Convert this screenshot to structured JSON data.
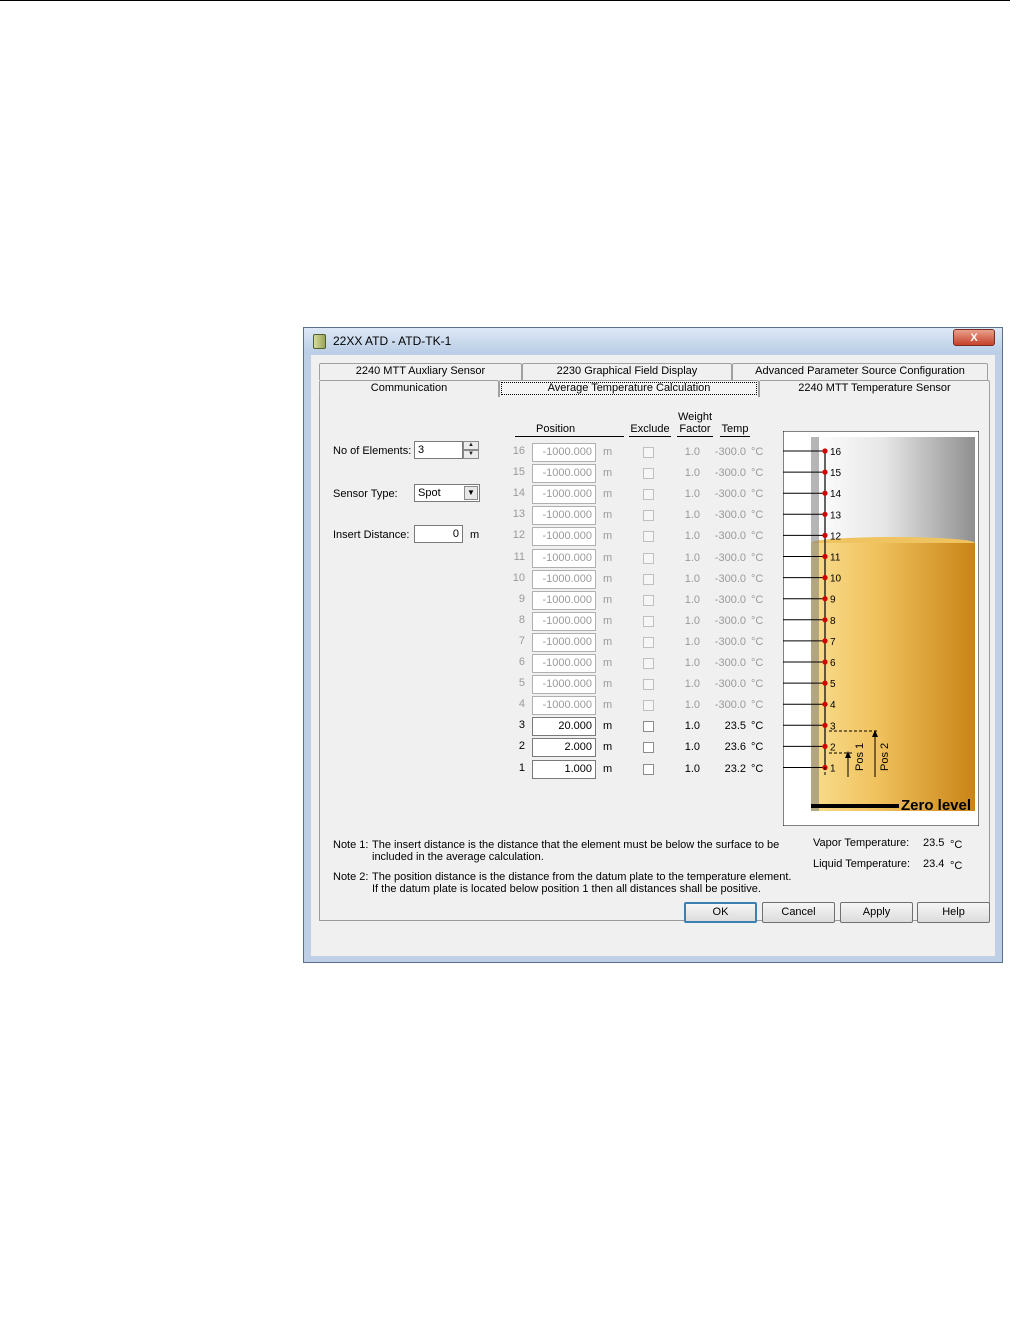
{
  "window": {
    "title": "22XX ATD  - ATD-TK-1",
    "close_label": "X"
  },
  "tabs": {
    "back": [
      {
        "label": "2240 MTT Auxliary Sensor"
      },
      {
        "label": "2230 Graphical Field Display"
      },
      {
        "label": "Advanced Parameter Source Configuration"
      }
    ],
    "front": [
      {
        "label": "Communication"
      },
      {
        "label": "Average Temperature Calculation",
        "active": true
      },
      {
        "label": "2240 MTT Temperature Sensor"
      }
    ]
  },
  "form": {
    "no_elements_label": "No of Elements:",
    "no_elements_value": "3",
    "sensor_type_label": "Sensor Type:",
    "sensor_type_value": "Spot",
    "insert_distance_label": "Insert Distance:",
    "insert_distance_value": "0",
    "insert_distance_unit": "m"
  },
  "table": {
    "headers": {
      "position": "Position",
      "exclude": "Exclude",
      "weight_factor_1": "Weight",
      "weight_factor_2": "Factor",
      "temp": "Temp"
    },
    "rows": [
      {
        "num": "16",
        "position": "-1000.000",
        "unit": "m",
        "weight": "1.0",
        "temp": "-300.0",
        "temp_unit": "°C",
        "enabled": false
      },
      {
        "num": "15",
        "position": "-1000.000",
        "unit": "m",
        "weight": "1.0",
        "temp": "-300.0",
        "temp_unit": "°C",
        "enabled": false
      },
      {
        "num": "14",
        "position": "-1000.000",
        "unit": "m",
        "weight": "1.0",
        "temp": "-300.0",
        "temp_unit": "°C",
        "enabled": false
      },
      {
        "num": "13",
        "position": "-1000.000",
        "unit": "m",
        "weight": "1.0",
        "temp": "-300.0",
        "temp_unit": "°C",
        "enabled": false
      },
      {
        "num": "12",
        "position": "-1000.000",
        "unit": "m",
        "weight": "1.0",
        "temp": "-300.0",
        "temp_unit": "°C",
        "enabled": false
      },
      {
        "num": "11",
        "position": "-1000.000",
        "unit": "m",
        "weight": "1.0",
        "temp": "-300.0",
        "temp_unit": "°C",
        "enabled": false
      },
      {
        "num": "10",
        "position": "-1000.000",
        "unit": "m",
        "weight": "1.0",
        "temp": "-300.0",
        "temp_unit": "°C",
        "enabled": false
      },
      {
        "num": "9",
        "position": "-1000.000",
        "unit": "m",
        "weight": "1.0",
        "temp": "-300.0",
        "temp_unit": "°C",
        "enabled": false
      },
      {
        "num": "8",
        "position": "-1000.000",
        "unit": "m",
        "weight": "1.0",
        "temp": "-300.0",
        "temp_unit": "°C",
        "enabled": false
      },
      {
        "num": "7",
        "position": "-1000.000",
        "unit": "m",
        "weight": "1.0",
        "temp": "-300.0",
        "temp_unit": "°C",
        "enabled": false
      },
      {
        "num": "6",
        "position": "-1000.000",
        "unit": "m",
        "weight": "1.0",
        "temp": "-300.0",
        "temp_unit": "°C",
        "enabled": false
      },
      {
        "num": "5",
        "position": "-1000.000",
        "unit": "m",
        "weight": "1.0",
        "temp": "-300.0",
        "temp_unit": "°C",
        "enabled": false
      },
      {
        "num": "4",
        "position": "-1000.000",
        "unit": "m",
        "weight": "1.0",
        "temp": "-300.0",
        "temp_unit": "°C",
        "enabled": false
      },
      {
        "num": "3",
        "position": "20.000",
        "unit": "m",
        "weight": "1.0",
        "temp": "23.5",
        "temp_unit": "°C",
        "enabled": true
      },
      {
        "num": "2",
        "position": "2.000",
        "unit": "m",
        "weight": "1.0",
        "temp": "23.6",
        "temp_unit": "°C",
        "enabled": true
      },
      {
        "num": "1",
        "position": "1.000",
        "unit": "m",
        "weight": "1.0",
        "temp": "23.2",
        "temp_unit": "°C",
        "enabled": true
      }
    ]
  },
  "tank": {
    "element_labels": [
      "16",
      "15",
      "14",
      "13",
      "12",
      "11",
      "10",
      "9",
      "8",
      "7",
      "6",
      "5",
      "4",
      "3",
      "2",
      "1"
    ],
    "pos1_label": "Pos 1",
    "pos2_label": "Pos 2",
    "zero_level_label": "Zero level",
    "colors": {
      "liquid": "#d9a132",
      "vapor": "#e0e0e0",
      "marker": "#d40000"
    },
    "vapor_temp_label": "Vapor Temperature:",
    "vapor_temp_value": "23.5",
    "liquid_temp_label": "Liquid Temperature:",
    "liquid_temp_value": "23.4",
    "temp_unit": "°C"
  },
  "notes": {
    "note1_label": "Note 1:",
    "note1_line1": "The insert distance is the distance that the element must be below the surface to be",
    "note1_line2": "included in the average calculation.",
    "note2_label": "Note 2:",
    "note2_line1": "The position distance is the distance from the datum plate to the temperature element.",
    "note2_line2": "If the datum plate is located below position 1 then all distances shall be positive."
  },
  "buttons": {
    "ok": "OK",
    "cancel": "Cancel",
    "apply": "Apply",
    "help": "Help"
  }
}
